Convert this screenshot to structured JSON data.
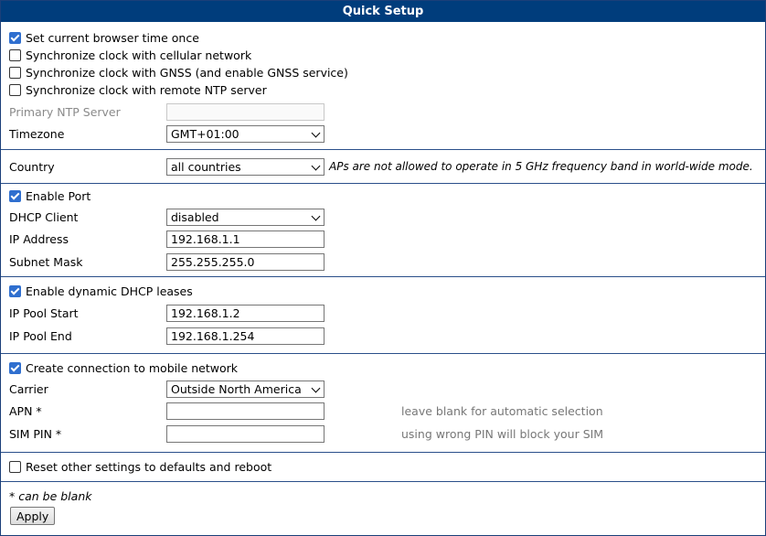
{
  "title": "Quick Setup",
  "time": {
    "options": [
      {
        "label": "Set current browser time once",
        "checked": true
      },
      {
        "label": "Synchronize clock with cellular network",
        "checked": false
      },
      {
        "label": "Synchronize clock with GNSS (and enable GNSS service)",
        "checked": false
      },
      {
        "label": "Synchronize clock with remote NTP server",
        "checked": false
      }
    ],
    "ntp_label": "Primary NTP Server",
    "ntp_value": "",
    "timezone_label": "Timezone",
    "timezone_value": "GMT+01:00"
  },
  "wifi": {
    "country_label": "Country",
    "country_value": "all countries",
    "country_note": "APs are not allowed to operate in 5 GHz frequency band in world-wide mode."
  },
  "lan": {
    "enable_label": "Enable Port",
    "enable_checked": true,
    "dhcp_client_label": "DHCP Client",
    "dhcp_client_value": "disabled",
    "ip_label": "IP Address",
    "ip_value": "192.168.1.1",
    "mask_label": "Subnet Mask",
    "mask_value": "255.255.255.0"
  },
  "dhcp": {
    "enable_label": "Enable dynamic DHCP leases",
    "enable_checked": true,
    "start_label": "IP Pool Start",
    "start_value": "192.168.1.2",
    "end_label": "IP Pool End",
    "end_value": "192.168.1.254"
  },
  "mobile": {
    "enable_label": "Create connection to mobile network",
    "enable_checked": true,
    "carrier_label": "Carrier",
    "carrier_value": "Outside North America",
    "apn_label": "APN *",
    "apn_value": "",
    "apn_hint": "leave blank for automatic selection",
    "pin_label": "SIM PIN *",
    "pin_value": "",
    "pin_hint": "using wrong PIN will block your SIM"
  },
  "reset": {
    "label": "Reset other settings to defaults and reboot",
    "checked": false
  },
  "footer": {
    "note": "* can be blank",
    "apply_label": "Apply"
  }
}
